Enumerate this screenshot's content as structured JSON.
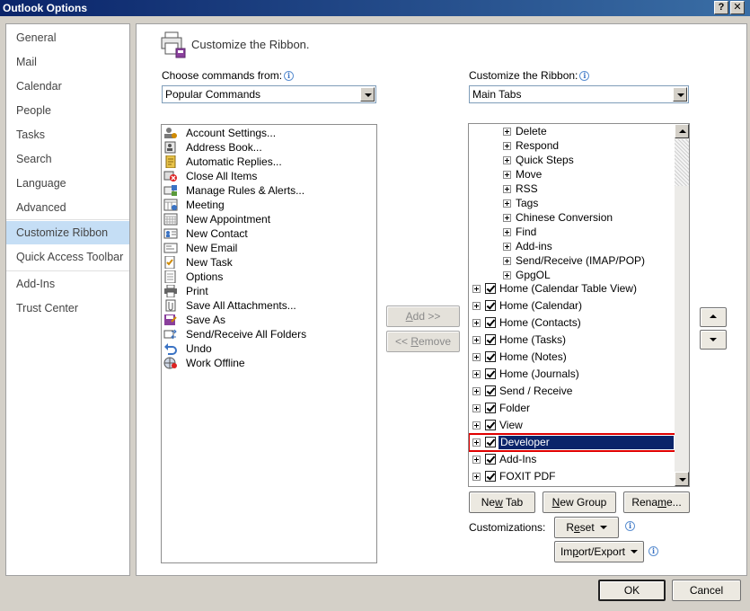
{
  "window": {
    "title": "Outlook Options",
    "help_label": "?",
    "close_label": "✕"
  },
  "nav": {
    "items": [
      {
        "label": "General"
      },
      {
        "label": "Mail"
      },
      {
        "label": "Calendar"
      },
      {
        "label": "People"
      },
      {
        "label": "Tasks"
      },
      {
        "label": "Search"
      },
      {
        "label": "Language"
      },
      {
        "label": "Advanced"
      },
      {
        "label": "Customize Ribbon"
      },
      {
        "label": "Quick Access Toolbar"
      },
      {
        "label": "Add-Ins"
      },
      {
        "label": "Trust Center"
      }
    ],
    "selected": "Customize Ribbon"
  },
  "header": {
    "title": "Customize the Ribbon."
  },
  "commands": {
    "label": "Choose commands from:",
    "selected": "Popular Commands",
    "items": [
      "Account Settings...",
      "Address Book...",
      "Automatic Replies...",
      "Close All Items",
      "Manage Rules & Alerts...",
      "Meeting",
      "New Appointment",
      "New Contact",
      "New Email",
      "New Task",
      "Options",
      "Print",
      "Save All Attachments...",
      "Save As",
      "Send/Receive All Folders",
      "Undo",
      "Work Offline"
    ]
  },
  "ribbon": {
    "label": "Customize the Ribbon:",
    "selected": "Main Tabs",
    "groups": [
      "Delete",
      "Respond",
      "Quick Steps",
      "Move",
      "RSS",
      "Tags",
      "Chinese Conversion",
      "Find",
      "Add-ins",
      "Send/Receive (IMAP/POP)",
      "GpgOL"
    ],
    "tabs": [
      {
        "label": "Home (Calendar Table View)",
        "checked": true
      },
      {
        "label": "Home (Calendar)",
        "checked": true
      },
      {
        "label": "Home (Contacts)",
        "checked": true
      },
      {
        "label": "Home (Tasks)",
        "checked": true
      },
      {
        "label": "Home (Notes)",
        "checked": true
      },
      {
        "label": "Home (Journals)",
        "checked": true
      },
      {
        "label": "Send / Receive",
        "checked": true
      },
      {
        "label": "Folder",
        "checked": true
      },
      {
        "label": "View",
        "checked": true
      },
      {
        "label": "Developer",
        "checked": true,
        "selected": true
      },
      {
        "label": "Add-Ins",
        "checked": true
      },
      {
        "label": "FOXIT PDF",
        "checked": true
      }
    ]
  },
  "buttons": {
    "add_pre": "",
    "add_u": "A",
    "add_post": "dd >>",
    "remove_pre": "<< ",
    "remove_u": "R",
    "remove_post": "emove",
    "new_tab_pre": "Ne",
    "new_tab_u": "w",
    "new_tab_post": " Tab",
    "new_group_pre": "",
    "new_group_u": "N",
    "new_group_post": "ew Group",
    "rename_pre": "Rena",
    "rename_u": "m",
    "rename_post": "e...",
    "customizations_label": "Customizations:",
    "reset_pre": "R",
    "reset_u": "e",
    "reset_post": "set",
    "import_export_pre": "Im",
    "import_export_u": "p",
    "import_export_post": "ort/Export",
    "ok": "OK",
    "cancel": "Cancel"
  },
  "colors": {
    "selection": "#0a246a",
    "highlight_border": "#e00000",
    "nav_selected": "#c5def5"
  }
}
